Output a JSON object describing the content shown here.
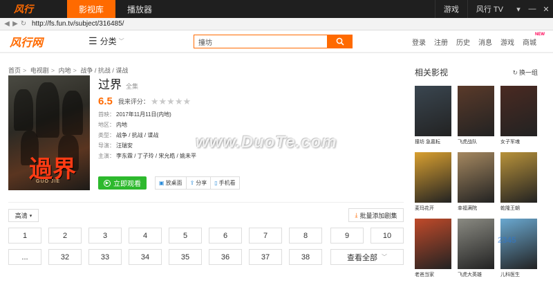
{
  "titlebar": {
    "logo": "风行",
    "tabs": [
      {
        "label": "影视库",
        "active": true
      },
      {
        "label": "播放器",
        "active": false
      }
    ],
    "right": [
      "游戏",
      "风行 TV"
    ],
    "win": [
      "▾",
      "—",
      "✕"
    ]
  },
  "address": {
    "url": "http://fs.fun.tv/subject/316485/"
  },
  "header": {
    "logo": "风行网",
    "category": "分类",
    "search_value": "撞坊",
    "right": [
      "登录",
      "注册",
      "历史",
      "消息",
      "游戏",
      "商城"
    ],
    "new_badge": "NEW"
  },
  "breadcrumb": [
    "首页",
    "电视剧",
    "内地",
    "战争 / 抗战 / 谍战"
  ],
  "show": {
    "poster_title": "過界",
    "poster_subtitle": "GUO JIE",
    "title": "过界",
    "full_label": "全集",
    "score": "6.5",
    "my_rating_label": "我来评分：",
    "stars": "★★★★★",
    "meta": [
      {
        "k": "首映：",
        "v": "2017年11月11日(内地)"
      },
      {
        "k": "地区：",
        "v": "内地"
      },
      {
        "k": "类型：",
        "v": "战争 / 抗战 / 谍战"
      },
      {
        "k": "导演：",
        "v": "汪瑞安"
      },
      {
        "k": "主演：",
        "v": "李东霖 / 丁子玲 / 宋允皓 / 姚未平"
      }
    ],
    "watch_label": "立即观看",
    "small_buttons": [
      {
        "icon": "▣",
        "label": "放桌面"
      },
      {
        "icon": "⇪",
        "label": "分享"
      },
      {
        "icon": "▯",
        "label": "手机看"
      }
    ]
  },
  "episodes": {
    "quality_label": "高清",
    "batch_label": "批量添加剧集",
    "row1": [
      "1",
      "2",
      "3",
      "4",
      "5",
      "6",
      "7",
      "8",
      "9",
      "10"
    ],
    "row2": [
      "...",
      "32",
      "33",
      "34",
      "35",
      "36",
      "37",
      "38"
    ],
    "view_all_label": "查看全部"
  },
  "related": {
    "title": "相关影视",
    "refresh_label": "换一组",
    "items": [
      {
        "name": "撞坊 急嘉耘",
        "color": "#3a4650"
      },
      {
        "name": "飞虎战队",
        "color": "#5a3a2a"
      },
      {
        "name": "女子军魂",
        "color": "#4a2a22"
      },
      {
        "name": "麦玛花开",
        "color": "#d9a030"
      },
      {
        "name": "幸福满院",
        "color": "#a58860"
      },
      {
        "name": "乾隆王朝",
        "color": "#b8923a"
      },
      {
        "name": "老爸当家",
        "color": "#c04a2a"
      },
      {
        "name": "飞虎大英雄",
        "color": "#8a8a82"
      },
      {
        "name": "儿科医生",
        "color": "#6aa8d0"
      }
    ]
  },
  "watermark": "www.DuoTe.com",
  "corner_mark": "2345"
}
